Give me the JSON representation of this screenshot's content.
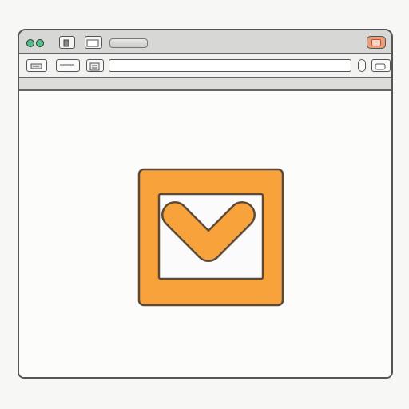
{
  "window": {
    "address_bar": {
      "value": ""
    }
  },
  "icons": {
    "traffic_lights": "window-control-dots-icon",
    "page": "page-icon",
    "tab": "tab-icon",
    "back": "back-icon",
    "forward": "forward-icon",
    "reader": "reader-icon",
    "close": "close-icon",
    "logo": "checkmark-box-icon"
  },
  "colors": {
    "accent": "#f7a23a",
    "accent_dark": "#e08a1f",
    "close": "#e7a07a",
    "traffic_green": "#4fc08a"
  }
}
